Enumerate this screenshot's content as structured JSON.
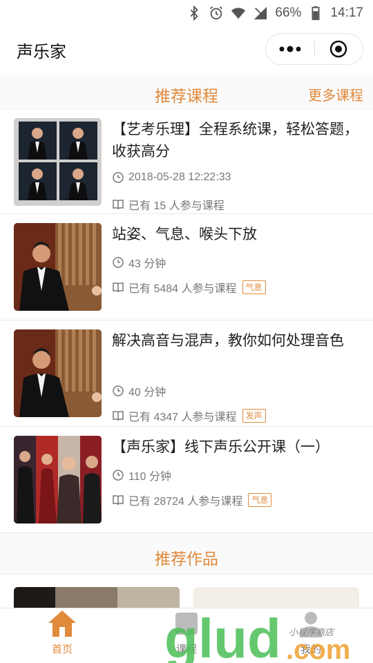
{
  "status_bar": {
    "battery": "66%",
    "time": "14:17"
  },
  "nav": {
    "title": "声乐家"
  },
  "recommended_courses": {
    "title": "推荐课程",
    "more_label": "更多课程",
    "items": [
      {
        "title": "【艺考乐理】全程系统课，轻松答题，收获高分",
        "time": "2018-05-28 12:22:33",
        "participants": "已有 15 人参与课程",
        "tag": ""
      },
      {
        "title": "站姿、气息、喉头下放",
        "time": "43 分钟",
        "participants": "已有 5484 人参与课程",
        "tag": "气息"
      },
      {
        "title": "解决高音与混声，教你如何处理音色",
        "time": "40 分钟",
        "participants": "已有 4347 人参与课程",
        "tag": "发声"
      },
      {
        "title": "【声乐家】线下声乐公开课（一）",
        "time": "110 分钟",
        "participants": "已有 28724 人参与课程",
        "tag": "气息"
      }
    ]
  },
  "recommended_works": {
    "title": "推荐作品"
  },
  "tabs": [
    {
      "label": "首页",
      "active": true
    },
    {
      "label": "课程",
      "active": false
    },
    {
      "label": "我的",
      "active": false
    }
  ],
  "watermark": {
    "brand": "glud.com",
    "slogan": "小程序商店"
  },
  "colors": {
    "accent": "#e08a3c",
    "watermark_green": "#4bbf57",
    "watermark_orange": "#f0a030"
  }
}
